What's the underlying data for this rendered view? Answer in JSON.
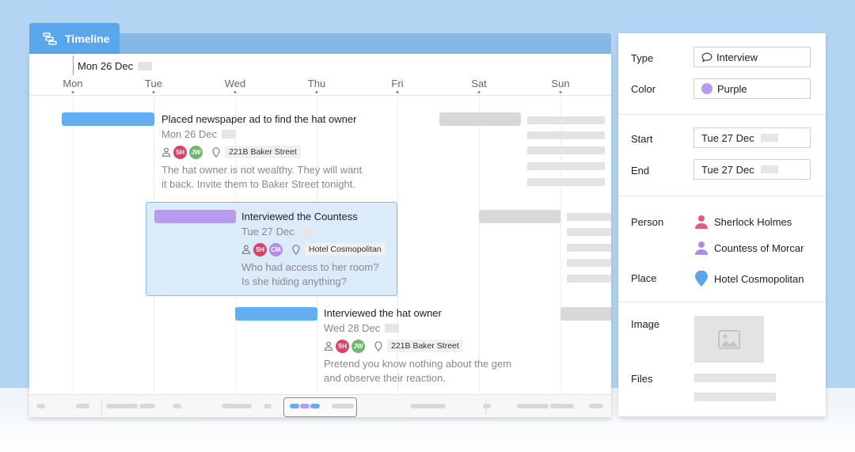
{
  "tab": {
    "label": "Timeline"
  },
  "timeline": {
    "top_date": "Mon 26 Dec",
    "days": [
      "Mon",
      "Tue",
      "Wed",
      "Thu",
      "Fri",
      "Sat",
      "Sun"
    ]
  },
  "events": [
    {
      "title": "Placed newspaper ad to find the hat owner",
      "date": "Mon 26 Dec",
      "avatars": [
        "SH",
        "JW"
      ],
      "place": "221B Baker Street",
      "description": [
        "The hat owner is not wealthy. They will want",
        "it back. Invite them to Baker Street tonight."
      ],
      "color": "#63aef0"
    },
    {
      "title": "Interviewed the Countess",
      "date": "Tue 27 Dec",
      "avatars": [
        "SH",
        "CM"
      ],
      "place": "Hotel Cosmopolitan",
      "description": [
        "Who had access to her room?",
        "Is she hiding anything?"
      ],
      "color": "#b79bf0"
    },
    {
      "title": "Interviewed the hat owner",
      "date": "Wed 28 Dec",
      "avatars": [
        "SH",
        "JW"
      ],
      "place": "221B Baker Street",
      "description": [
        "Pretend you know nothing about the gem",
        "and observe their reaction."
      ],
      "color": "#63aef0"
    }
  ],
  "details": {
    "type_label": "Type",
    "type_value": "Interview",
    "color_label": "Color",
    "color_value": "Purple",
    "color_swatch": "#b79bf0",
    "start_label": "Start",
    "start_value": "Tue 27 Dec",
    "end_label": "End",
    "end_value": "Tue 27 Dec",
    "person_label": "Person",
    "persons": [
      "Sherlock Holmes",
      "Countess of Morcar"
    ],
    "place_label": "Place",
    "place_value": "Hotel Cosmopolitan",
    "image_label": "Image",
    "files_label": "Files"
  },
  "colors": {
    "accent": "#5aa6ea",
    "selection": "#dcebfa",
    "person_red": "#e8577b",
    "person_purple": "#b08ae6"
  }
}
